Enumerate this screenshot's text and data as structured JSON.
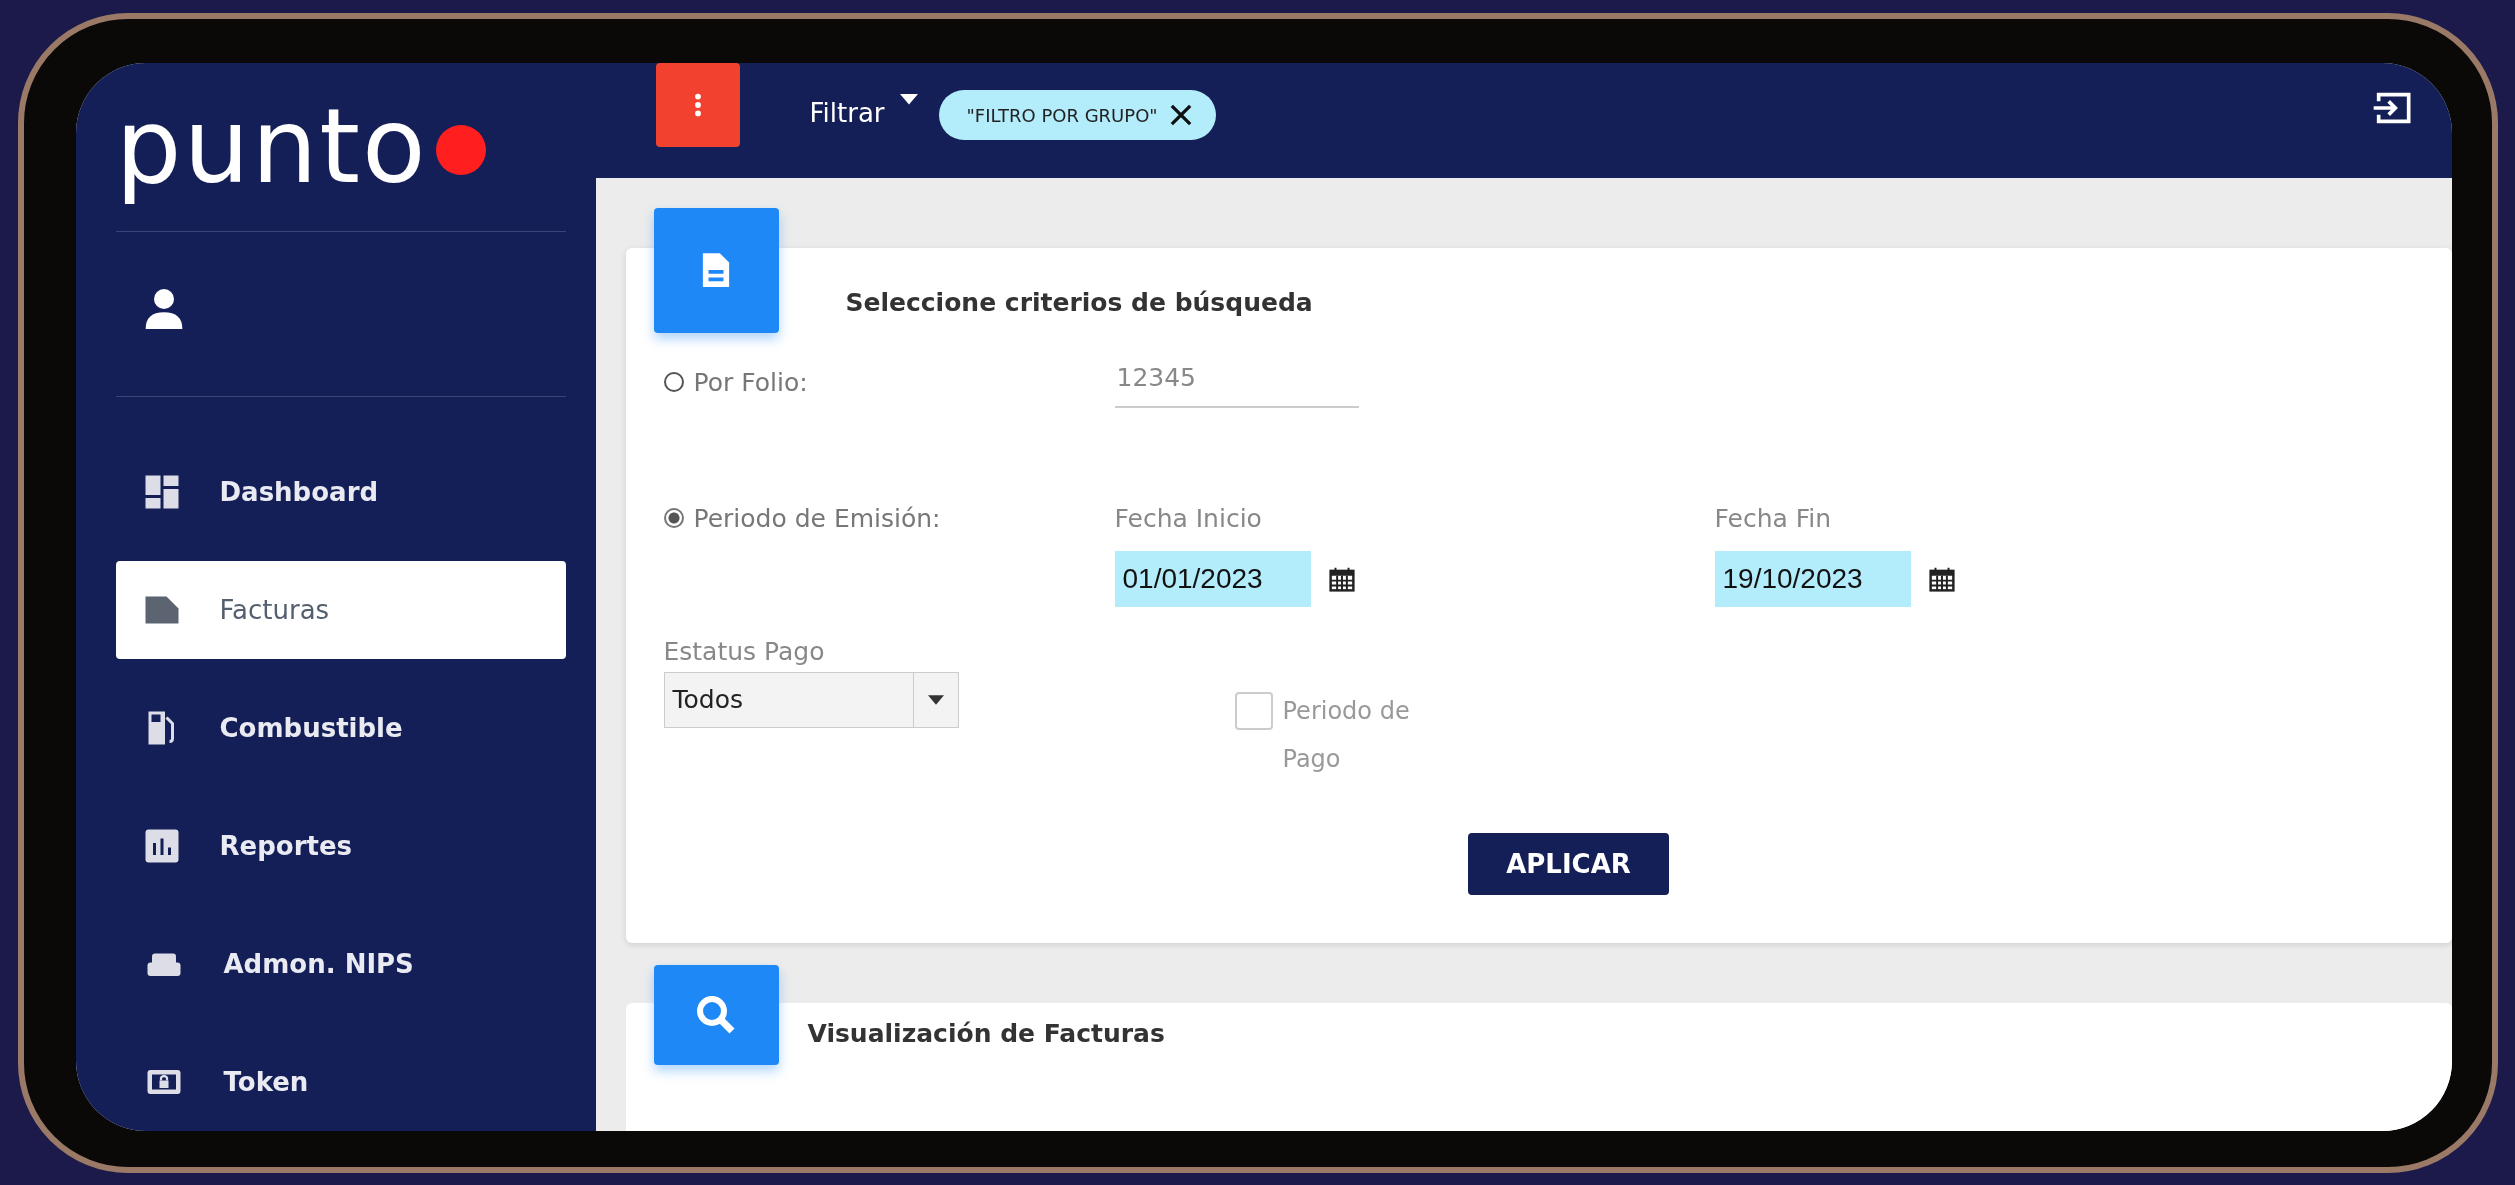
{
  "logo": {
    "text": "punto"
  },
  "sidebar": {
    "items": [
      {
        "label": "Dashboard",
        "kind": "dashboard",
        "selected": false
      },
      {
        "label": "Facturas",
        "kind": "invoice",
        "selected": true
      },
      {
        "label": "Combustible",
        "kind": "fuel",
        "selected": false
      },
      {
        "label": "Reportes",
        "kind": "report",
        "selected": false
      },
      {
        "label": "Admon. NIPS",
        "kind": "sofa",
        "selected": false
      },
      {
        "label": "Token",
        "kind": "token",
        "selected": false
      }
    ]
  },
  "topbar": {
    "filter_label": "Filtrar",
    "chip": "\"FILTRO POR GRUPO\""
  },
  "search_card": {
    "title": "Seleccione criterios de búsqueda",
    "folio": {
      "label": "Por Folio:",
      "selected": false,
      "placeholder": "12345"
    },
    "period": {
      "label": "Periodo de Emisión:",
      "selected": true,
      "start_label": "Fecha Inicio",
      "start_value": "01/01/2023",
      "end_label": "Fecha Fin",
      "end_value": "19/10/2023"
    },
    "status": {
      "label": "Estatus Pago",
      "value": "Todos"
    },
    "payment_period": {
      "label": "Periodo de Pago",
      "checked": false
    },
    "apply_button": "APLICAR"
  },
  "results_card": {
    "title": "Visualización de Facturas"
  }
}
